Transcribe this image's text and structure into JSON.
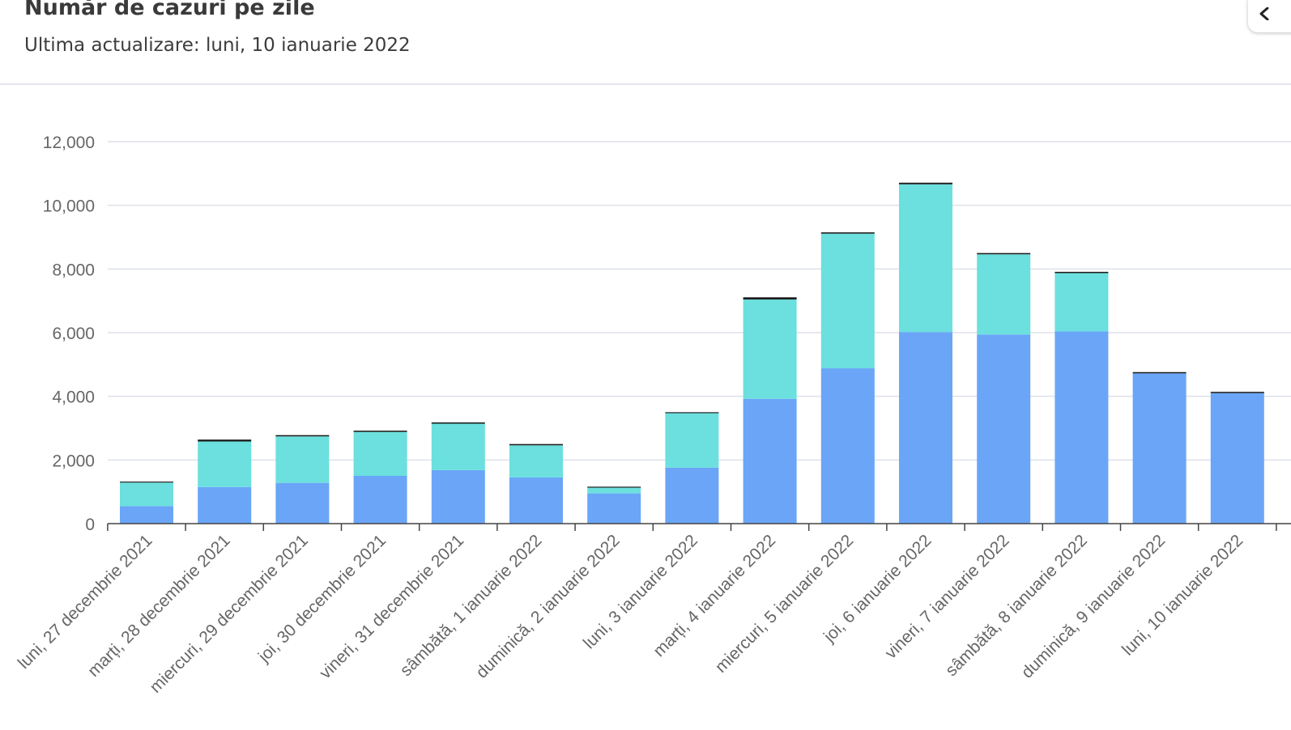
{
  "header": {
    "title": "Număr de cazuri pe zile",
    "subtitle": "Ultima actualizare: luni, 10 ianuarie 2022"
  },
  "icons": {
    "collapse": "chevron-left-icon"
  },
  "colors": {
    "series_bottom": "#6aa5f8",
    "series_middle": "#6be0de",
    "series_top": "#1c1c1c",
    "grid": "#dde1ea",
    "axis": "#444444",
    "tick_label": "#666666"
  },
  "chart_data": {
    "type": "bar",
    "stacked": true,
    "title": "Număr de cazuri pe zile",
    "xlabel": "",
    "ylabel": "",
    "ylim": [
      0,
      12000
    ],
    "yticks": [
      0,
      2000,
      4000,
      6000,
      8000,
      10000,
      12000
    ],
    "ytick_labels": [
      "0",
      "2,000",
      "4,000",
      "6,000",
      "8,000",
      "10,000",
      "12,000"
    ],
    "grid": true,
    "legend": "none",
    "categories": [
      "luni, 27 decembrie 2021",
      "marți, 28 decembrie 2021",
      "miercuri, 29 decembrie 2021",
      "joi, 30 decembrie 2021",
      "vineri, 31 decembrie 2021",
      "sâmbătă, 1 ianuarie 2022",
      "duminică, 2 ianuarie 2022",
      "luni, 3 ianuarie 2022",
      "marți, 4 ianuarie 2022",
      "miercuri, 5 ianuarie 2022",
      "joi, 6 ianuarie 2022",
      "vineri, 7 ianuarie 2022",
      "sâmbătă, 8 ianuarie 2022",
      "duminică, 9 ianuarie 2022",
      "luni, 10 ianuarie 2022"
    ],
    "series": [
      {
        "color": "#6aa5f8",
        "values": [
          550,
          1150,
          1280,
          1500,
          1680,
          1450,
          950,
          1760,
          3920,
          4880,
          6020,
          5940,
          6040,
          4720,
          4100
        ]
      },
      {
        "color": "#6be0de",
        "values": [
          740,
          1430,
          1460,
          1380,
          1460,
          1010,
          180,
          1710,
          3120,
          4230,
          4640,
          2520,
          1830,
          0,
          0
        ]
      },
      {
        "color": "#1c1c1c",
        "values": [
          30,
          60,
          40,
          40,
          40,
          40,
          30,
          30,
          70,
          40,
          50,
          40,
          40,
          40,
          40
        ]
      }
    ]
  }
}
